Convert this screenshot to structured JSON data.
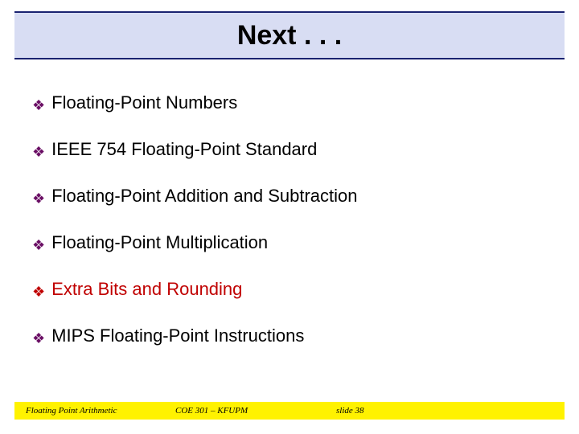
{
  "title": "Next . . .",
  "bullets": [
    {
      "text": "Floating-Point Numbers",
      "current": false
    },
    {
      "text": "IEEE 754 Floating-Point Standard",
      "current": false
    },
    {
      "text": "Floating-Point Addition and Subtraction",
      "current": false
    },
    {
      "text": "Floating-Point Multiplication",
      "current": false
    },
    {
      "text": "Extra Bits and Rounding",
      "current": true
    },
    {
      "text": "MIPS Floating-Point Instructions",
      "current": false
    }
  ],
  "footer": {
    "left": "Floating Point Arithmetic",
    "mid": "COE 301 – KFUPM",
    "right": "slide 38"
  },
  "colors": {
    "title_bg": "#d8ddf3",
    "title_border": "#1a2270",
    "bullet_icon": "#6a0e64",
    "highlight": "#c00000",
    "footer_bg": "#fff200"
  },
  "chart_data": null
}
